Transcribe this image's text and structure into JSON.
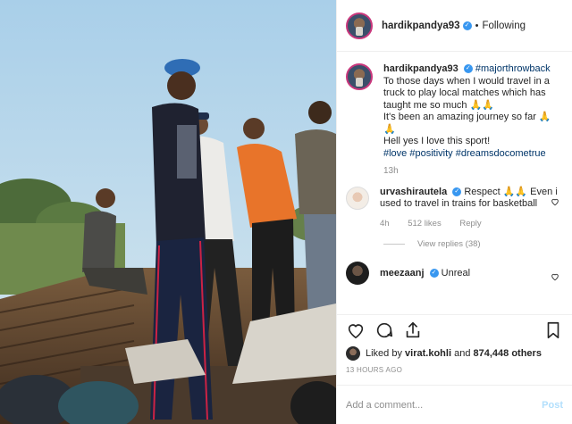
{
  "post": {
    "username": "hardikpandya93",
    "follow_status": "Following"
  },
  "caption": {
    "username": "hardikpandya93",
    "hashtag_lead": "#majorthrowback",
    "line1": "To those days when I would travel in a truck to play local matches which has taught me so much 🙏🙏",
    "line2": "It's been an amazing journey so far 🙏🙏",
    "line3": "Hell yes I love this sport!",
    "hashtags": "#love #positivity #dreamsdocometrue",
    "time": "13h"
  },
  "comments": [
    {
      "username": "urvashirautela",
      "text": "Respect 🙏🙏 Even i used to travel in trains for basketball",
      "time": "4h",
      "likes": "512 likes",
      "reply": "Reply",
      "view_replies": "View replies (38)"
    },
    {
      "username": "meezaanj",
      "text": "Unreal"
    }
  ],
  "likes": {
    "prefix": "Liked by",
    "first_user": "virat.kohli",
    "joiner": "and",
    "others": "874,448 others"
  },
  "timestamp": "13 HOURS AGO",
  "add_comment": {
    "placeholder": "Add a comment...",
    "post_label": "Post"
  },
  "icons": {
    "like": "heart-icon",
    "comment": "comment-icon",
    "share": "share-icon",
    "save": "bookmark-icon",
    "verified": "verified-badge-icon"
  },
  "colors": {
    "link": "#003569",
    "verified": "#3897f0",
    "muted": "#8e8e8e",
    "post_disabled": "#b2dffc"
  }
}
